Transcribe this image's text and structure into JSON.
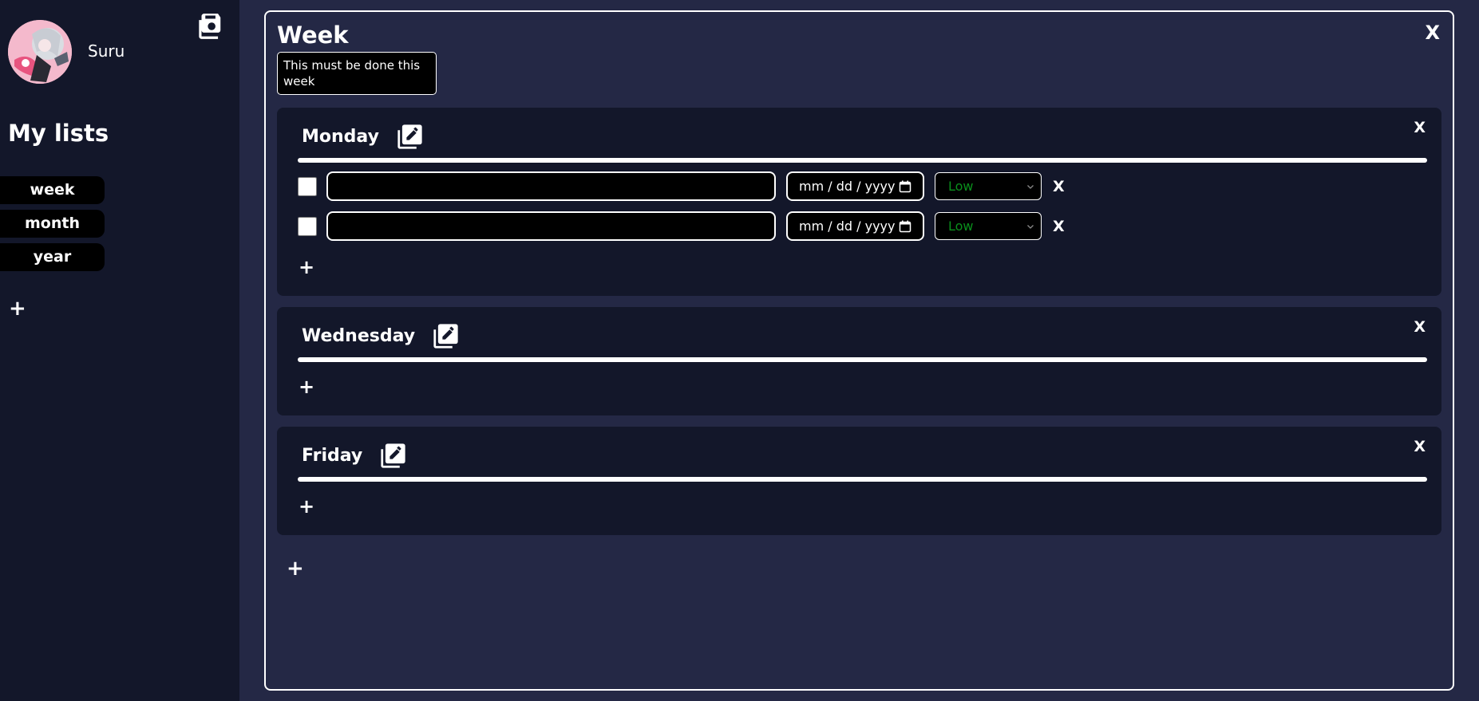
{
  "sidebar": {
    "username": "Suru",
    "lists_heading": "My lists",
    "lists": [
      {
        "label": "week"
      },
      {
        "label": "month"
      },
      {
        "label": "year"
      }
    ],
    "add_label": "+",
    "save_icon": "floppy-disk-icon"
  },
  "list": {
    "title": "Week",
    "close_label": "X",
    "description": "This must be done this week",
    "add_day_label": "+",
    "days": [
      {
        "name": "Monday",
        "close_label": "X",
        "edit_icon": "edit-copy-icon",
        "add_task_label": "+",
        "tasks": [
          {
            "text": "",
            "checked": false,
            "date_placeholder": "mm / dd / yyyy",
            "priority": "Low",
            "delete_label": "X"
          },
          {
            "text": "",
            "checked": false,
            "date_placeholder": "mm / dd / yyyy",
            "priority": "Low",
            "delete_label": "X"
          }
        ]
      },
      {
        "name": "Wednesday",
        "close_label": "X",
        "edit_icon": "edit-copy-icon",
        "add_task_label": "+",
        "tasks": []
      },
      {
        "name": "Friday",
        "close_label": "X",
        "edit_icon": "edit-copy-icon",
        "add_task_label": "+",
        "tasks": []
      }
    ]
  },
  "colors": {
    "page_background": "#242845",
    "sidebar_background": "#13172a",
    "card_background": "#13172a",
    "priority_low": "#0a8f1c"
  }
}
